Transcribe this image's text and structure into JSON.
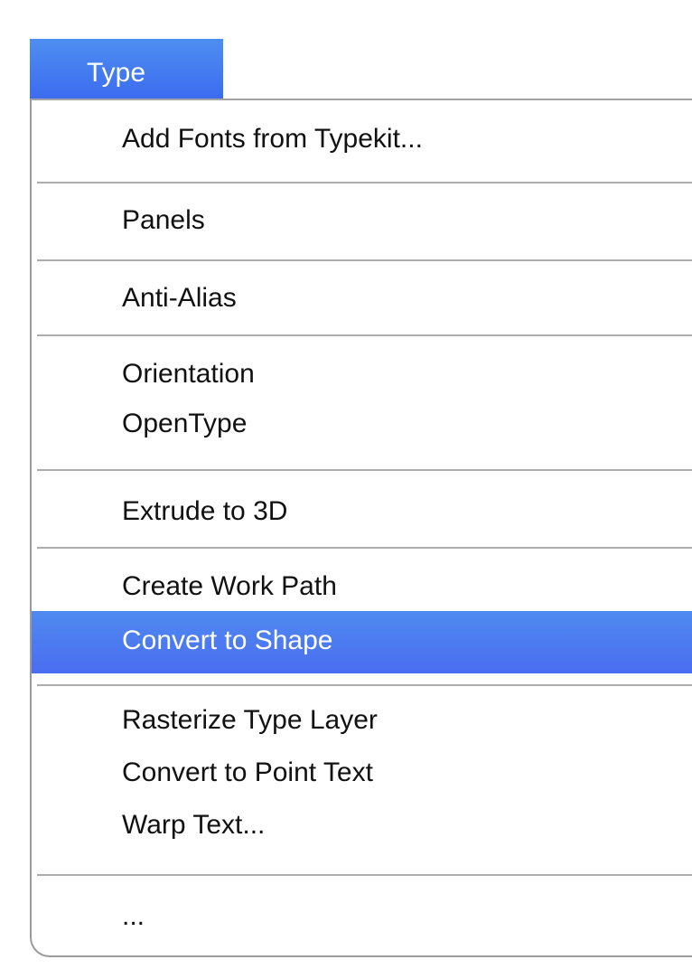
{
  "menu": {
    "title": "Type",
    "items": [
      {
        "label": "Add Fonts from Typekit..."
      },
      {
        "label": "Panels"
      },
      {
        "label": "Anti-Alias"
      },
      {
        "label": "Orientation"
      },
      {
        "label": "OpenType"
      },
      {
        "label": "Extrude to 3D"
      },
      {
        "label": "Create Work Path"
      },
      {
        "label": "Convert to Shape",
        "selected": true
      },
      {
        "label": "Rasterize Type Layer"
      },
      {
        "label": "Convert to Point Text"
      },
      {
        "label": "Warp Text..."
      },
      {
        "label": "..."
      }
    ]
  },
  "colors": {
    "accent": "#4a78f0"
  }
}
